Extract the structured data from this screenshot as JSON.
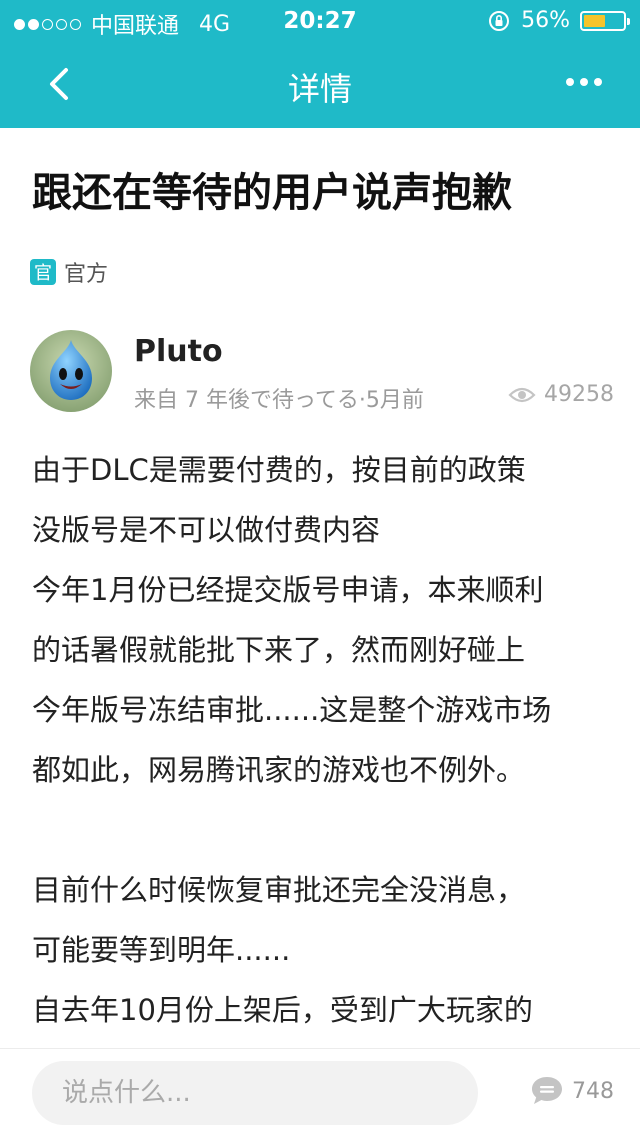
{
  "status_bar": {
    "carrier": "中国联通",
    "network": "4G",
    "time": "20:27",
    "battery": "56%",
    "battery_level": 0.56
  },
  "nav": {
    "title": "详情",
    "back_icon": "chevron-left-icon",
    "more_icon": "more-horizontal-icon"
  },
  "article": {
    "title": "跟还在等待的用户说声抱歉",
    "tag_badge": "官",
    "tag_label": "官方",
    "author": "Pluto",
    "meta": "来自 7 年後で待ってる·5月前",
    "views": "49258",
    "body_lines": [
      "由于DLC是需要付费的，按目前的政策",
      "没版号是不可以做付费内容",
      "今年1月份已经提交版号申请，本来顺利",
      "的话暑假就能批下来了，然而刚好碰上",
      "今年版号冻结审批......这是整个游戏市场",
      "都如此，网易腾讯家的游戏也不例外。",
      "",
      "目前什么时候恢复审批还完全没消息，",
      "可能要等到明年......",
      "自去年10月份上架后，受到广大玩家的"
    ]
  },
  "bottom_bar": {
    "comment_placeholder": "说点什么...",
    "comment_count": "748"
  },
  "colors": {
    "accent": "#1fbac8",
    "battery": "#f6c42b"
  }
}
